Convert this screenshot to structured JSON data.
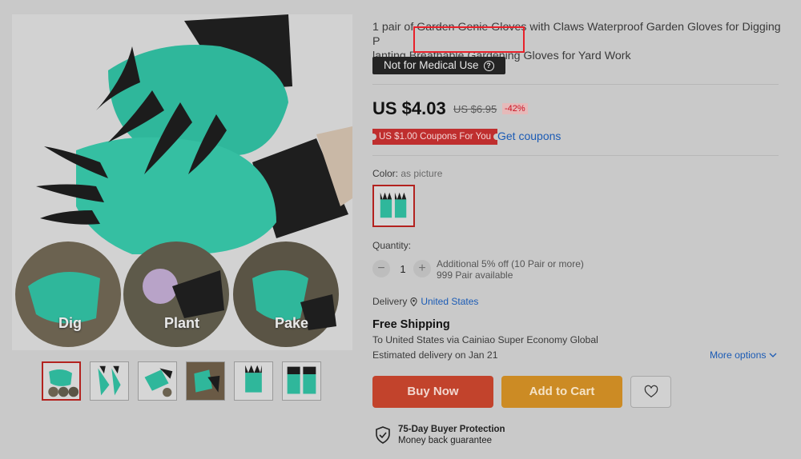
{
  "product": {
    "title": "1 pair of Garden Genie Gloves with Claws Waterproof Garden Gloves for Digging Planting Breathable Gardening Gloves for Yard Work",
    "title_line1": "1 pair of Garden Genie Gloves with Claws Waterproof Garden Gloves for Digging P",
    "title_line2": "lanting Breathable Gardening Gloves for Yard Work",
    "medical_badge": "Not for Medical Use",
    "price": "US $4.03",
    "old_price": "US $6.95",
    "discount": "-42%",
    "coupon_badge": "US $1.00 Coupons For You",
    "get_coupons": "Get coupons"
  },
  "gallery": {
    "captions": [
      "Dig",
      "Plant",
      "Pake"
    ],
    "thumbnail_count": 6
  },
  "options": {
    "color_label": "Color:",
    "color_value": "as picture",
    "quantity_label": "Quantity:",
    "quantity_value": "1",
    "minus": "−",
    "plus": "+",
    "qty_offer": "Additional 5% off (10 Pair or more)",
    "qty_available": "999 Pair available"
  },
  "shipping": {
    "delivery_label": "Delivery",
    "delivery_location": "United States",
    "free_shipping": "Free Shipping",
    "ship_via": "To United States via Cainiao Super Economy Global",
    "estimated": "Estimated delivery on Jan 21",
    "more_options": "More options"
  },
  "actions": {
    "buy_now": "Buy Now",
    "add_to_cart": "Add to Cart"
  },
  "protection": {
    "title": "75-Day Buyer Protection",
    "subtitle": "Money back guarantee"
  },
  "colors": {
    "glove_teal": "#2fb79b",
    "claw_black": "#1c1c1c",
    "accent_red": "#e8212a",
    "link_blue": "#1b5bb5"
  }
}
